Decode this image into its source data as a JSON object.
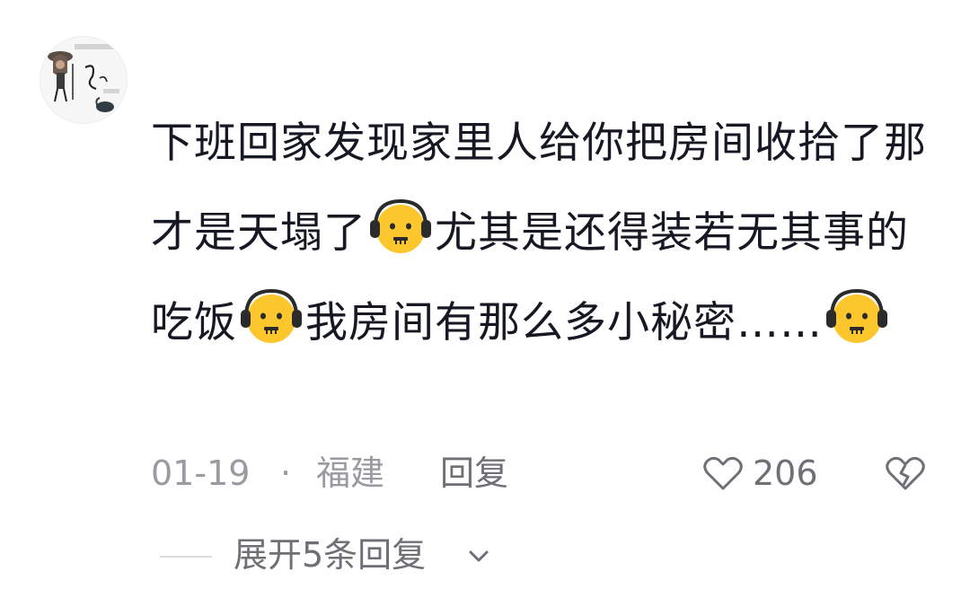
{
  "comment": {
    "avatar_icon": "user-avatar-illustration",
    "text_segments": [
      "下班回家发现家里人给你把房间收拾了那才是天塌了",
      "尤其是还得装若无其事的吃饭",
      "我房间有那么多小秘密……"
    ],
    "emoji_name": "headphones-grimace-emoji",
    "date": "01-19",
    "separator": "·",
    "location": "福建",
    "reply_label": "回复",
    "like_icon": "heart-icon",
    "like_count": "206",
    "dislike_icon": "broken-heart-icon",
    "expand_label": "展开5条回复",
    "expand_icon": "chevron-down-icon"
  },
  "colors": {
    "text_primary": "#161823",
    "text_meta": "#9a9aa0",
    "text_secondary": "#6f6f76"
  }
}
